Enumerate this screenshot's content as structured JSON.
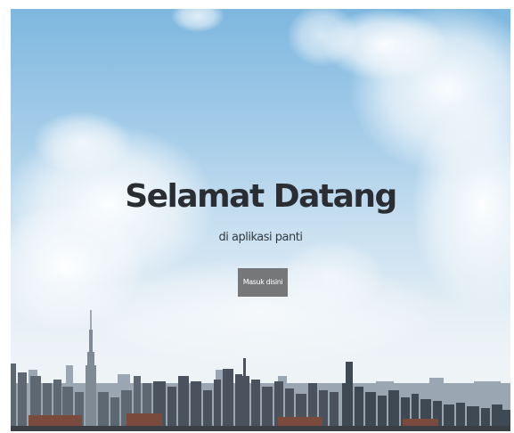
{
  "hero": {
    "title": "Selamat Datang",
    "subtitle": "di aplikasi panti",
    "button_label": "Masuk disini",
    "background": "city-skyline-clouds-photo"
  },
  "colors": {
    "title": "#2a2e33",
    "button_bg": "#757779",
    "button_text": "#ffffff",
    "sky": "#7eb7df"
  }
}
